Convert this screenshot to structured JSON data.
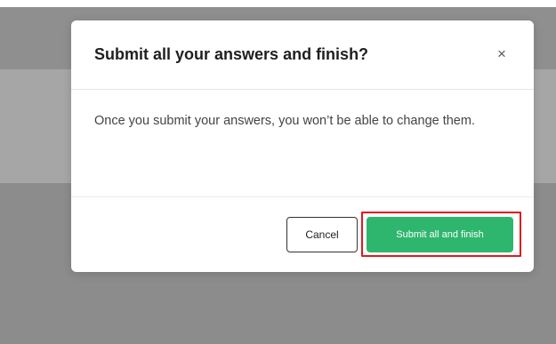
{
  "modal": {
    "title": "Submit all your answers and finish?",
    "close_icon_glyph": "×",
    "message": "Once you submit your answers, you won’t be able to change them.",
    "cancel_label": "Cancel",
    "submit_label": "Submit all and finish"
  },
  "colors": {
    "submit_button": "#2fb66e",
    "highlight_outline": "#e0191f",
    "overlay": "#8f8f8f"
  }
}
